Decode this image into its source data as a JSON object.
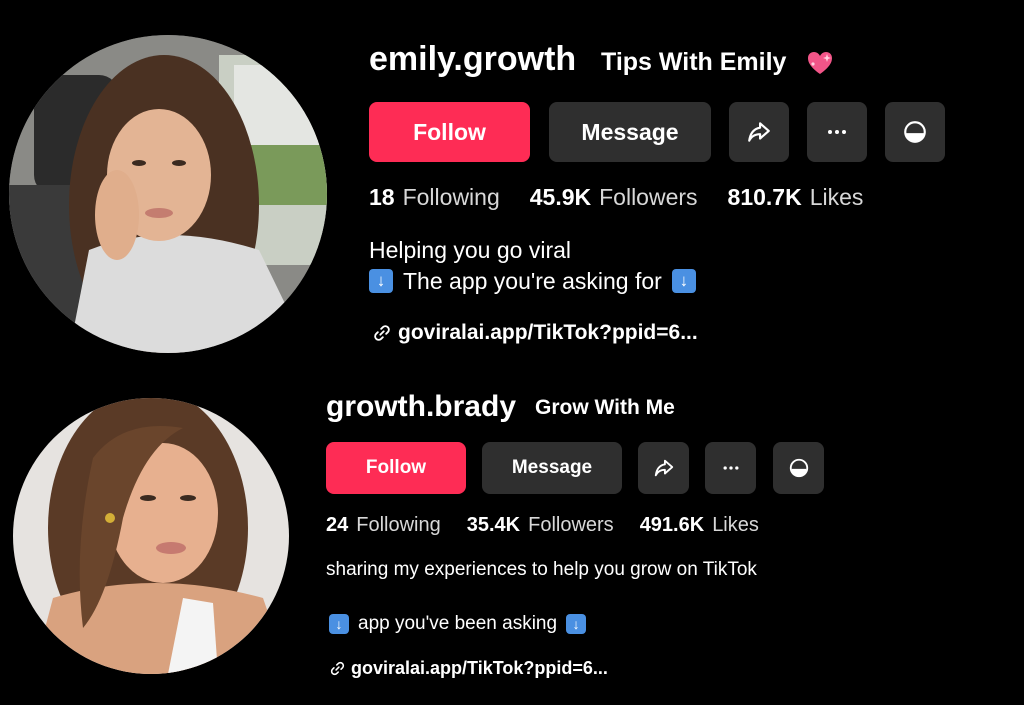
{
  "profiles": [
    {
      "username": "emily.growth",
      "nickname": "Tips With Emily",
      "nickname_icon": "sparkling-heart-icon",
      "buttons": {
        "follow": "Follow",
        "message": "Message",
        "share_icon": "share-icon",
        "more_icon": "more-options-icon",
        "block_icon": "block-icon"
      },
      "stats": {
        "following_count": "18",
        "following_label": "Following",
        "followers_count": "45.9K",
        "followers_label": "Followers",
        "likes_count": "810.7K",
        "likes_label": "Likes"
      },
      "bio": {
        "line1": "Helping you go viral",
        "line2": "The app you're asking for",
        "line2_icons": [
          "down-arrow-emoji-icon",
          "down-arrow-emoji-icon"
        ]
      },
      "link": {
        "icon": "link-icon",
        "text": "goviralai.app/TikTok?ppid=6..."
      },
      "colors": {
        "follow_bg": "#fe2c55",
        "secondary_btn_bg": "#2f2f2f",
        "arrow_emoji_bg": "#4a90e2"
      }
    },
    {
      "username": "growth.brady",
      "nickname": "Grow With Me",
      "buttons": {
        "follow": "Follow",
        "message": "Message",
        "share_icon": "share-icon",
        "more_icon": "more-options-icon",
        "block_icon": "block-icon"
      },
      "stats": {
        "following_count": "24",
        "following_label": "Following",
        "followers_count": "35.4K",
        "followers_label": "Followers",
        "likes_count": "491.6K",
        "likes_label": "Likes"
      },
      "bio": {
        "line1": "sharing my experiences to help you grow on TikTok",
        "line2": "app you've been asking",
        "line2_icons": [
          "down-arrow-emoji-icon",
          "down-arrow-emoji-icon"
        ]
      },
      "link": {
        "icon": "link-icon",
        "text": "goviralai.app/TikTok?ppid=6..."
      },
      "colors": {
        "follow_bg": "#fe2c55",
        "secondary_btn_bg": "#2f2f2f",
        "arrow_emoji_bg": "#4a90e2"
      }
    }
  ]
}
